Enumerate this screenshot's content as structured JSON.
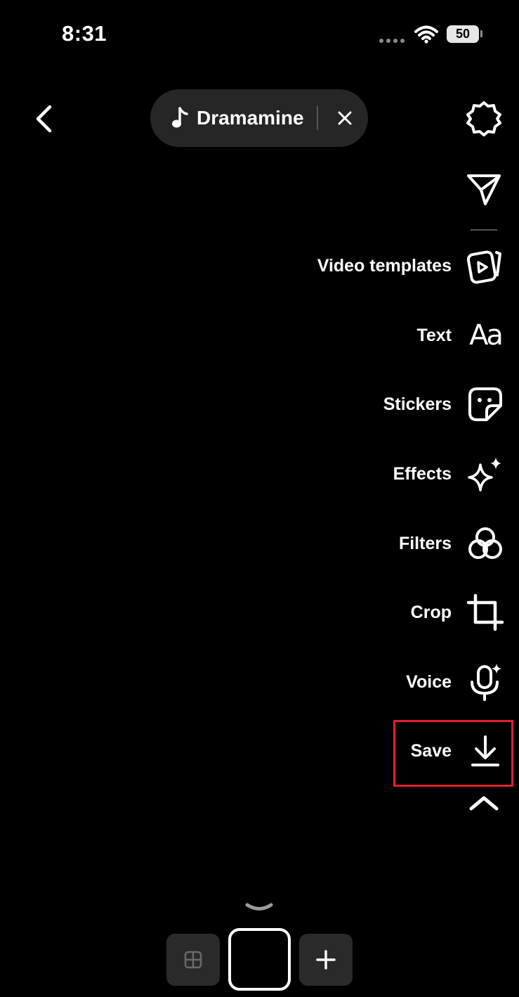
{
  "status_bar": {
    "time": "8:31",
    "battery_level": "50"
  },
  "top_bar": {
    "sound_name": "Dramamine"
  },
  "tools": [
    {
      "label": "Video templates",
      "icon": "video-templates-icon"
    },
    {
      "label": "Text",
      "icon": "text-aa-icon",
      "glyph": "Aa"
    },
    {
      "label": "Stickers",
      "icon": "sticker-icon"
    },
    {
      "label": "Effects",
      "icon": "sparkles-icon"
    },
    {
      "label": "Filters",
      "icon": "filters-icon"
    },
    {
      "label": "Crop",
      "icon": "crop-icon"
    },
    {
      "label": "Voice",
      "icon": "voice-icon"
    },
    {
      "label": "Save",
      "icon": "download-icon"
    }
  ],
  "highlight": {
    "target": "Save",
    "color": "#e02030"
  },
  "colors": {
    "background": "#000000",
    "pill": "#262626",
    "button": "#2a2a2a"
  }
}
